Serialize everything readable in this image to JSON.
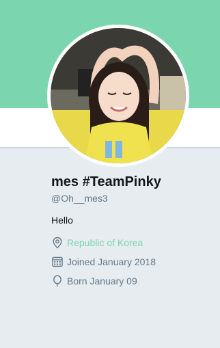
{
  "colors": {
    "banner": "#7bd6b0",
    "accent": "#7bd6b0",
    "page_background": "#e6ecf0",
    "text_primary": "#14171a",
    "text_secondary": "#657786"
  },
  "profile": {
    "display_name": "mes #TeamPinky",
    "handle": "@Oh__mes3",
    "bio": "Hello",
    "avatar_icon": "profile-photo"
  },
  "meta": {
    "location": {
      "icon": "location-pin-icon",
      "text": "Republic of Korea"
    },
    "joined": {
      "icon": "calendar-icon",
      "text": "Joined January 2018"
    },
    "born": {
      "icon": "balloon-icon",
      "text": "Born January 09"
    }
  }
}
